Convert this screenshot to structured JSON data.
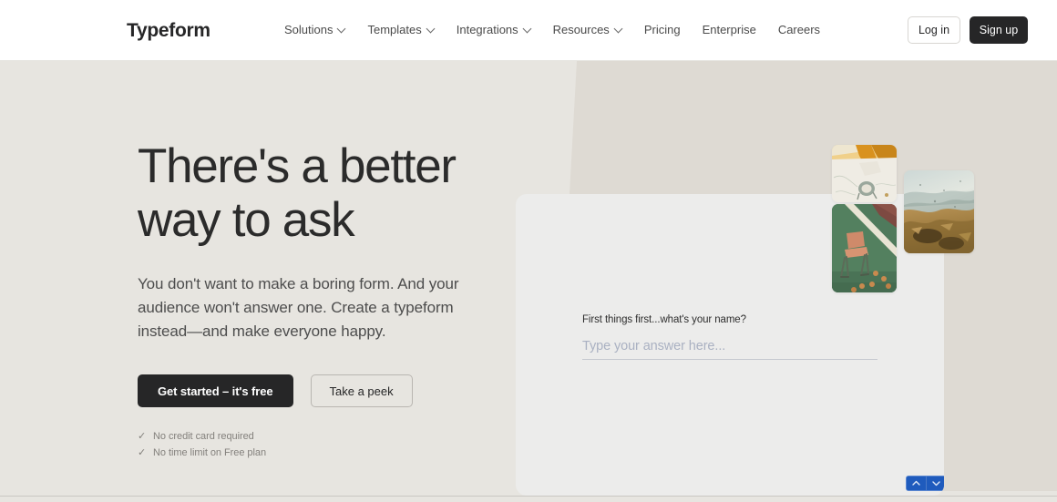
{
  "header": {
    "logo": "Typeform",
    "nav_items": [
      {
        "label": "Solutions",
        "has_dropdown": true
      },
      {
        "label": "Templates",
        "has_dropdown": true
      },
      {
        "label": "Integrations",
        "has_dropdown": true
      },
      {
        "label": "Resources",
        "has_dropdown": true
      },
      {
        "label": "Pricing",
        "has_dropdown": false
      },
      {
        "label": "Enterprise",
        "has_dropdown": false
      },
      {
        "label": "Careers",
        "has_dropdown": false
      }
    ],
    "login_label": "Log in",
    "signup_label": "Sign up"
  },
  "hero": {
    "headline_line1": "There's a better",
    "headline_line2": "way to ask",
    "subcopy": "You don't want to make a boring form. And your audience won't answer one. Create a typeform instead—and make everyone happy.",
    "cta_primary": "Get started – it's free",
    "cta_secondary": "Take a peek",
    "perks": [
      {
        "tick": "✓",
        "label": "No credit card required"
      },
      {
        "tick": "✓",
        "label": "No time limit on Free plan"
      }
    ]
  },
  "form_card": {
    "question": "First things first...what's your name?",
    "answer_value": "",
    "answer_placeholder": "Type your answer here...",
    "nav_up_icon": "chevron-up-icon",
    "nav_down_icon": "chevron-down-icon"
  },
  "collage": {
    "photos": [
      {
        "name": "photo-hand-drawing",
        "alt": "Hand drawing on white paper with yellow sleeve"
      },
      {
        "name": "photo-chair-tennis-court",
        "alt": "Orange folding chair on a green tennis court"
      },
      {
        "name": "photo-autumn-leaves",
        "alt": "Misty seascape over golden autumn leaves"
      }
    ]
  },
  "colors": {
    "page_bg": "#e7e5e0",
    "bg_shape": "#dedad3",
    "header_bg": "#ffffff",
    "dark": "#262627",
    "card_bg": "#ececeb",
    "accent_blue": "#1f5bbd",
    "muted_text": "#83807c"
  }
}
